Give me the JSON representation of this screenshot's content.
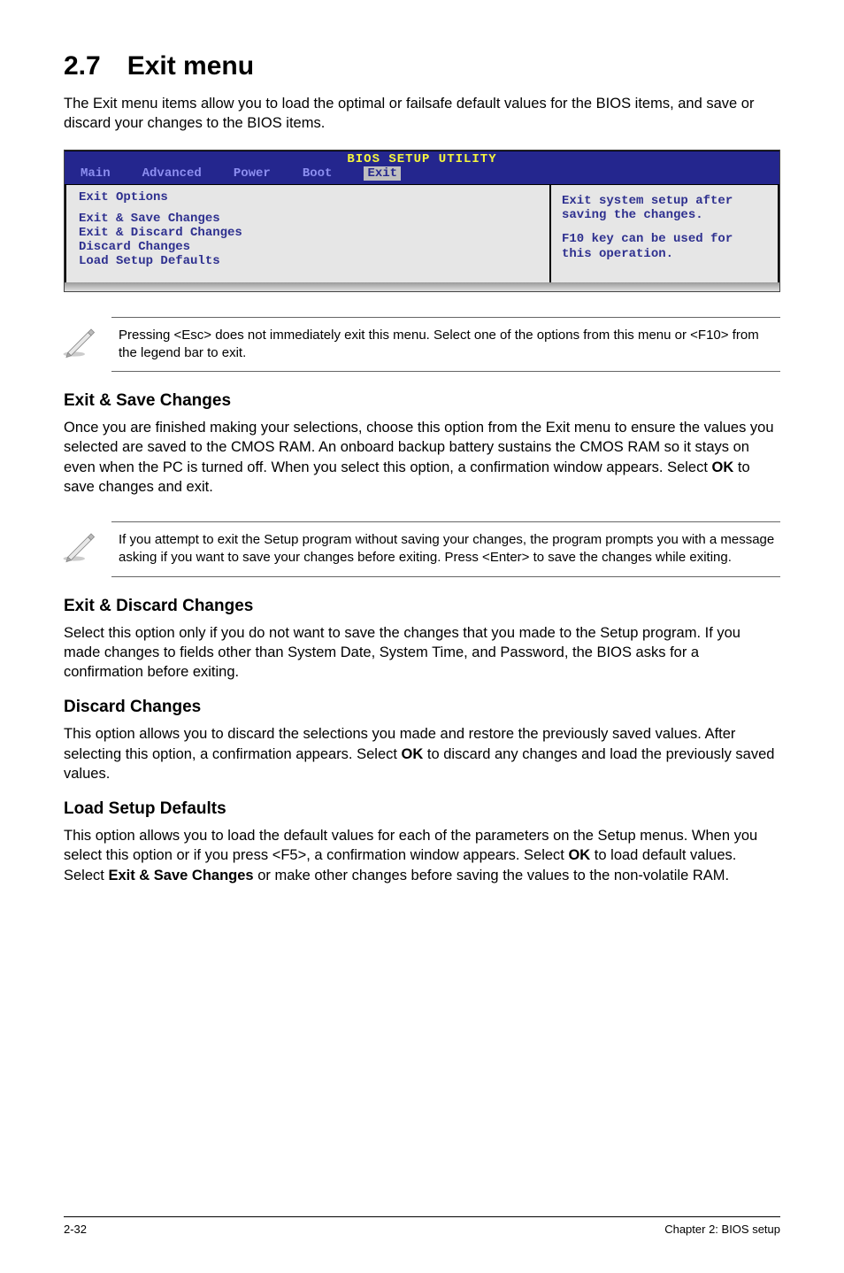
{
  "heading": "2.7 Exit menu",
  "intro": "The Exit menu items allow you to load the optimal or failsafe default values for the BIOS items, and save or discard your changes to the BIOS items.",
  "bios": {
    "title": "BIOS SETUP UTILITY",
    "tabs": [
      "Main",
      "Advanced",
      "Power",
      "Boot",
      "Exit"
    ],
    "active_tab_index": 4,
    "left_header": "Exit Options",
    "left_items": [
      "Exit & Save Changes",
      "Exit & Discard Changes",
      "Discard Changes",
      "",
      "Load Setup Defaults"
    ],
    "right_para1": "Exit system setup after saving the changes.",
    "right_para2": "F10 key can be used for this operation."
  },
  "note1": "Pressing <Esc> does not immediately exit this menu. Select one of the options from this menu or <F10> from the legend bar to exit.",
  "sec1_h": "Exit & Save Changes",
  "sec1_p_a": "Once you are finished making your selections, choose this option from the Exit menu to ensure the values you selected are saved to the CMOS RAM. An onboard backup battery sustains the CMOS RAM so it stays on even when the PC is turned off. When you select this option, a confirmation window appears. Select ",
  "sec1_ok": "OK",
  "sec1_p_b": " to save changes and exit.",
  "note2": " If you attempt to exit the Setup program without saving your changes, the program prompts you with a message asking if you want to save your changes before exiting. Press <Enter>  to save the  changes while exiting.",
  "sec2_h": "Exit & Discard Changes",
  "sec2_p": "Select this option only if you do not want to save the changes that you  made to the Setup program. If you made changes to fields other than System Date, System Time, and Password, the BIOS asks for a confirmation before exiting.",
  "sec3_h": "Discard Changes",
  "sec3_p_a": "This option allows you to discard the selections you made and restore the previously saved values. After selecting this option, a confirmation appears. Select ",
  "sec3_ok": "OK",
  "sec3_p_b": " to discard any changes and load the previously saved values.",
  "sec4_h": "Load Setup Defaults",
  "sec4_p_a": "This option allows you to load the default values for each of the parameters on the Setup menus. When you select this option or if you press <F5>, a confirmation window appears. Select ",
  "sec4_ok": "OK",
  "sec4_p_b": " to load default values. Select ",
  "sec4_exit": "Exit & Save Changes",
  "sec4_p_c": " or make other changes before saving the values to the non-volatile RAM.",
  "footer_left": "2-32",
  "footer_right": "Chapter 2: BIOS setup"
}
